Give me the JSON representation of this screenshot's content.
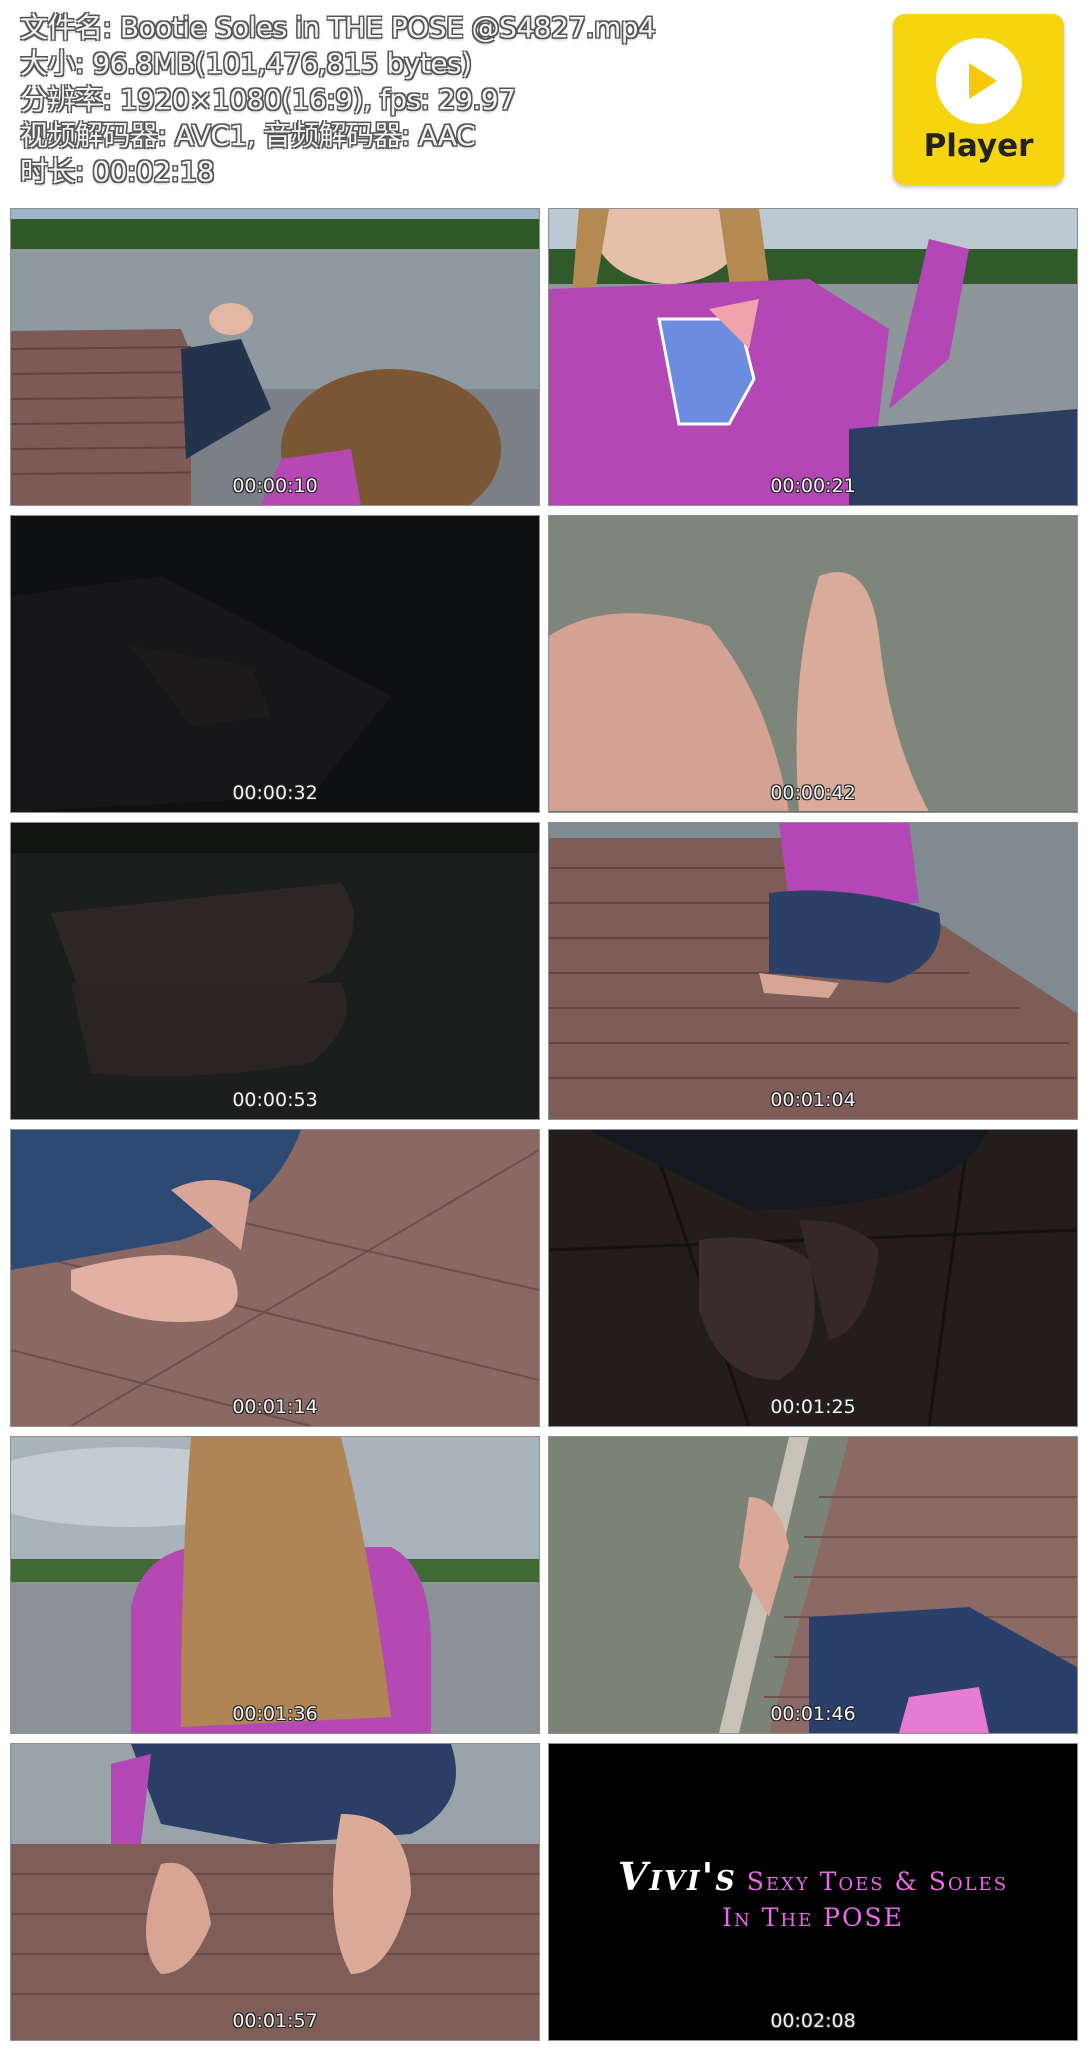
{
  "file_info": {
    "filename": "文件名: Bootie Soles in THE POSE @S4827.mp4",
    "size": "大小: 96.8MB(101,476,815 bytes)",
    "resolution": "分辨率: 1920×1080(16:9), fps: 29.97",
    "codec": "视频解码器: AVC1, 音频解码器: AAC",
    "duration": "时长: 00:02:18"
  },
  "player_logo": {
    "label": "Player",
    "icon": "play-icon",
    "color": "#f6d40f"
  },
  "thumbnails": [
    {
      "timestamp": "00:00:10"
    },
    {
      "timestamp": "00:00:21"
    },
    {
      "timestamp": "00:00:32"
    },
    {
      "timestamp": "00:00:42"
    },
    {
      "timestamp": "00:00:53"
    },
    {
      "timestamp": "00:01:04"
    },
    {
      "timestamp": "00:01:14"
    },
    {
      "timestamp": "00:01:25"
    },
    {
      "timestamp": "00:01:36"
    },
    {
      "timestamp": "00:01:46"
    },
    {
      "timestamp": "00:01:57"
    },
    {
      "timestamp": "00:02:08",
      "title_script": "Vivi's",
      "title_line1": "Sexy Toes & Soles",
      "title_line2": "In The POSE"
    }
  ]
}
